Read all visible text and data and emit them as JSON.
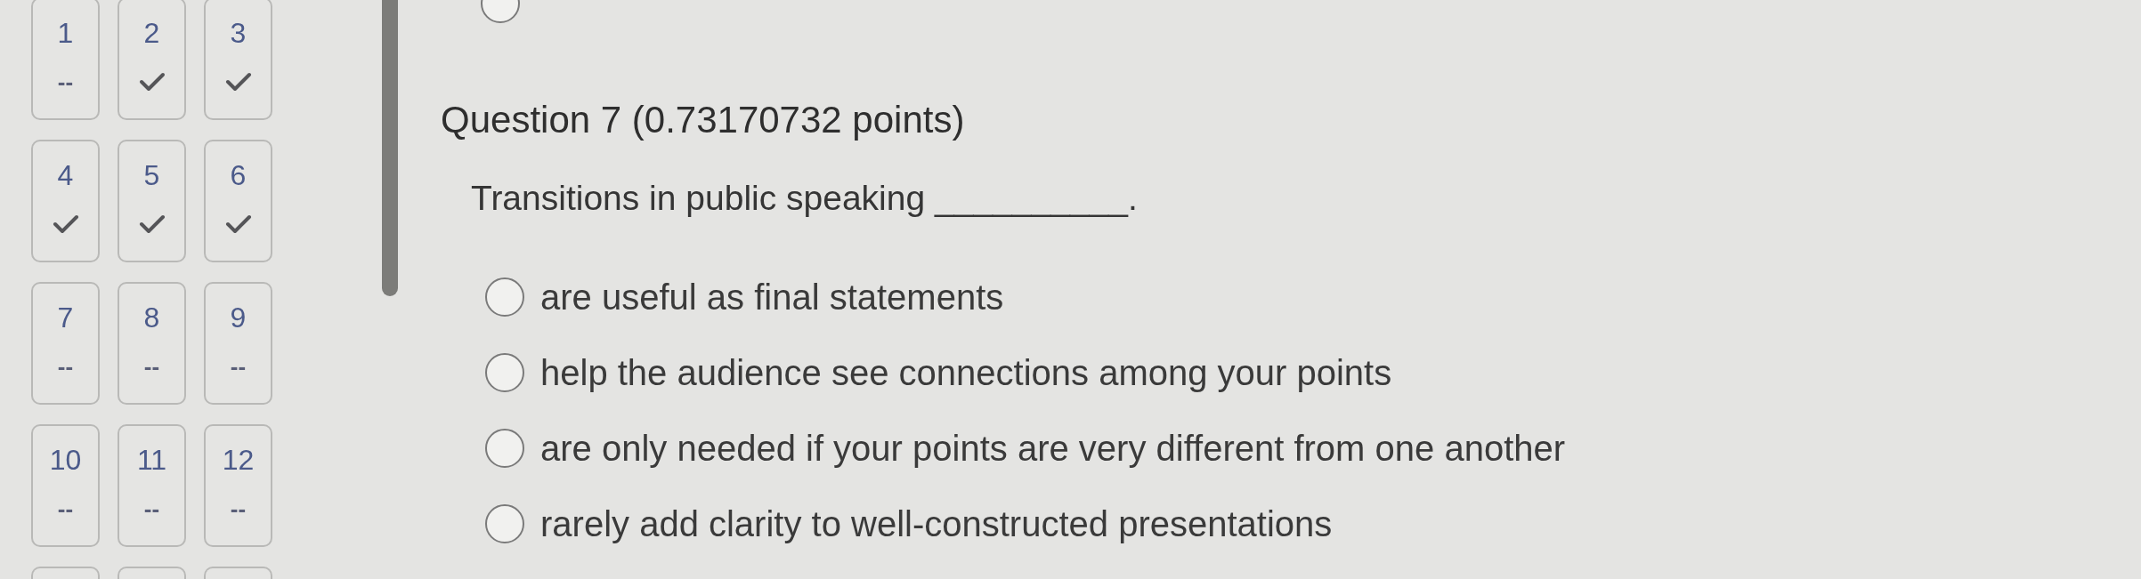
{
  "question_nav": {
    "tiles": [
      {
        "kind": "tile",
        "number": "1",
        "answered": false,
        "blank": "--"
      },
      {
        "kind": "tile",
        "number": "2",
        "answered": true
      },
      {
        "kind": "tile",
        "number": "3",
        "answered": true
      },
      {
        "kind": "tile",
        "number": "4",
        "answered": true
      },
      {
        "kind": "tile",
        "number": "5",
        "answered": true
      },
      {
        "kind": "tile",
        "number": "6",
        "answered": true
      },
      {
        "kind": "tile",
        "number": "7",
        "answered": false,
        "blank": "--"
      },
      {
        "kind": "tile",
        "number": "8",
        "answered": false,
        "blank": "--"
      },
      {
        "kind": "tile",
        "number": "9",
        "answered": false,
        "blank": "--"
      },
      {
        "kind": "tile",
        "number": "10",
        "answered": false,
        "blank": "--"
      },
      {
        "kind": "tile",
        "number": "11",
        "answered": false,
        "blank": "--"
      },
      {
        "kind": "tile",
        "number": "12",
        "answered": false,
        "blank": "--"
      },
      {
        "kind": "cut"
      },
      {
        "kind": "cut"
      },
      {
        "kind": "cut"
      }
    ]
  },
  "previous_question": {
    "options": [
      {
        "selected": false
      }
    ]
  },
  "question": {
    "title": "Question 7 (0.73170732 points)",
    "prompt": "Transitions in public speaking __________.",
    "options": [
      {
        "label": "are useful as final statements",
        "selected": false
      },
      {
        "label": "help the audience see connections among your points",
        "selected": false
      },
      {
        "label": "are only needed if your points are very different from one another",
        "selected": false
      },
      {
        "label": "rarely add clarity to well-constructed presentations",
        "selected": false
      }
    ]
  }
}
